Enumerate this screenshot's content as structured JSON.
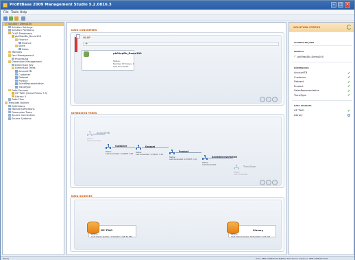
{
  "window": {
    "title": "ProfitBase 2009 Management Studio 5.2.0816.3"
  },
  "menu": [
    "File",
    "Tools",
    "Help"
  ],
  "tree": {
    "items": [
      {
        "label": "Solution: Demo100",
        "icon": "db-icon",
        "indent": 0,
        "selected": true
      },
      {
        "label": "Solution Settings",
        "icon": "doc-icon",
        "indent": 1
      },
      {
        "label": "Solution Partitions",
        "icon": "doc-icon",
        "indent": 1
      },
      {
        "label": "OLAP Databases",
        "icon": "db-icon",
        "indent": 1
      },
      {
        "label": "pb09apDb_Demo100",
        "icon": "db-icon",
        "indent": 2
      },
      {
        "label": "Finance",
        "icon": "folder-icon",
        "indent": 3
      },
      {
        "label": "Finance",
        "icon": "dim-icon",
        "indent": 4
      },
      {
        "label": "Sales",
        "icon": "folder-icon",
        "indent": 3
      },
      {
        "label": "Sales",
        "icon": "dim-icon",
        "indent": 4
      },
      {
        "label": "Modules",
        "icon": "folder-icon",
        "indent": 1
      },
      {
        "label": "Fact Management",
        "icon": "folder-icon",
        "indent": 1
      },
      {
        "label": "Processing",
        "icon": "doc-icon",
        "indent": 2
      },
      {
        "label": "Dimension Management",
        "icon": "folder-icon",
        "indent": 1
      },
      {
        "label": "Dimension Key",
        "icon": "doc-icon",
        "indent": 2
      },
      {
        "label": "Dimension Trees",
        "icon": "folder-icon",
        "indent": 2
      },
      {
        "label": "AccountTB",
        "icon": "dim-icon",
        "indent": 3
      },
      {
        "label": "Customer",
        "icon": "dim-icon",
        "indent": 3
      },
      {
        "label": "Dataset",
        "icon": "dim-icon",
        "indent": 3
      },
      {
        "label": "Product",
        "icon": "dim-icon",
        "indent": 3
      },
      {
        "label": "SalesRepresentative",
        "icon": "dim-icon",
        "indent": 3
      },
      {
        "label": "TransType",
        "icon": "dim-icon",
        "indent": 3
      },
      {
        "label": "Data Sources",
        "icon": "folder-icon",
        "indent": 1
      },
      {
        "label": "GP TWO (Great Plains 7.5)",
        "icon": "db-icon",
        "indent": 2
      },
      {
        "label": "Library 0",
        "icon": "db-icon",
        "indent": 2
      },
      {
        "label": "Data Flow",
        "icon": "doc-icon",
        "indent": 1
      },
      {
        "label": "Template Builder",
        "icon": "folder-icon",
        "indent": 0
      },
      {
        "label": "Definitions",
        "icon": "doc-icon",
        "indent": 1
      },
      {
        "label": "Module Definitions",
        "icon": "doc-icon",
        "indent": 1
      },
      {
        "label": "Dimension Trees",
        "icon": "doc-icon",
        "indent": 1
      },
      {
        "label": "Source Connection",
        "icon": "doc-icon",
        "indent": 1
      },
      {
        "label": "Source Systems",
        "icon": "doc-icon",
        "indent": 1
      }
    ]
  },
  "main": {
    "data_consumers_label": "DATA CONSUMERS",
    "olap_label": "OLAP",
    "olap_tag": "OLAP",
    "olap_card": {
      "title": "pb09apDb_Demo100",
      "status": "Status:",
      "cubes": "Number Of Cubes: 2",
      "processed": "Last Processed:"
    },
    "dimension_trees_label": "DIMENSION TREES",
    "dims": [
      {
        "name": "AccountTB",
        "status": "Status:",
        "generated": "Last Generated:",
        "faded": true
      },
      {
        "name": "Customer",
        "status": "Status:",
        "generated": "Last Generated: 1/3/2007 1:08",
        "faded": false
      },
      {
        "name": "Dataset",
        "status": "Status:",
        "generated": "Last Generated: 1/3/2007 1:26",
        "faded": false
      },
      {
        "name": "Product",
        "status": "Status:",
        "generated": "Last Generated: 1/3/2007 1:26",
        "faded": false
      },
      {
        "name": "SalesRepresentative",
        "status": "Status:",
        "generated": "Last Generated:",
        "faded": false
      },
      {
        "name": "TransType",
        "status": "Status:",
        "generated": "Last Generated:",
        "faded": true
      }
    ],
    "data_sources_label": "DATA SOURCES",
    "sources": [
      {
        "name": "GP TWO",
        "status": "Status:",
        "updated": "Last Data Update: 1/3/2007 1:08:34 PM"
      },
      {
        "name": "Library",
        "status": "Status:",
        "updated": "Last Data Update: 8/31/2007 1:04 AM"
      }
    ]
  },
  "side": {
    "title": "SOLUTION STATUS",
    "scheduled_label": "SCHEDULED JOBS",
    "models_label": "MODELS",
    "model_item": "pb09apDb_Demo100",
    "dimensions_label": "DIMENSIONS",
    "dimensions": [
      "AccountTB",
      "Customer",
      "Dataset",
      "Product",
      "SalesRepresentative",
      "TransType"
    ],
    "datasources_label": "DATA SOURCES",
    "datasources": [
      {
        "name": "GP TWO",
        "state": "ok"
      },
      {
        "name": "Library",
        "state": "pending"
      }
    ]
  },
  "status": {
    "left": "Ready",
    "right": "User: SBN-C90B3A7A18\\Peter    SQL Server Instance: SBN-C90B3A7A18"
  },
  "colors": {
    "accent": "#c85a0c",
    "ok": "#3f9b2e",
    "title_bar": "#2a5ea8"
  }
}
